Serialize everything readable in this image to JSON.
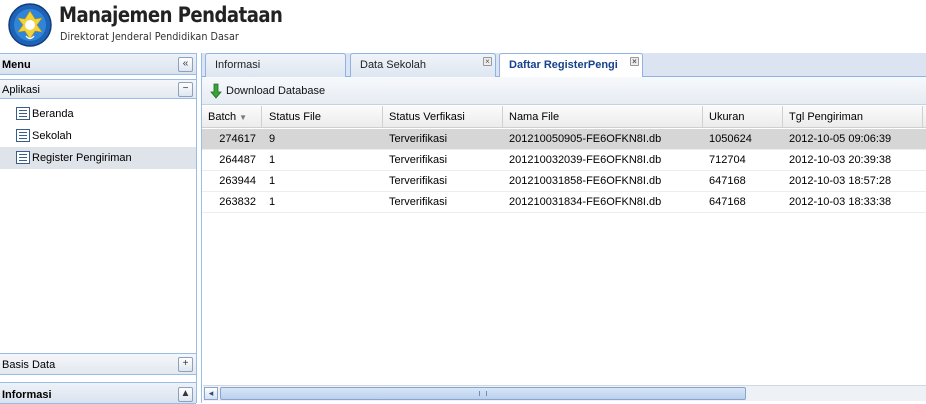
{
  "header": {
    "title": "Manajemen Pendataan",
    "subtitle": "Direktorat Jenderal Pendidikan Dasar"
  },
  "west": {
    "menu_title": "Menu",
    "aplikasi_title": "Aplikasi",
    "tree": [
      {
        "label": "Beranda"
      },
      {
        "label": "Sekolah"
      },
      {
        "label": "Register Pengiriman"
      }
    ],
    "basis_data_title": "Basis Data",
    "informasi_title": "Informasi"
  },
  "tabs": [
    {
      "label": "Informasi"
    },
    {
      "label": "Data Sekolah"
    },
    {
      "label": "Daftar RegisterPengi"
    }
  ],
  "toolbar": {
    "download_label": "Download Database"
  },
  "grid": {
    "columns": [
      "Batch",
      "Status File",
      "Status Verfikasi",
      "Nama File",
      "Ukuran",
      "Tgl Pengiriman"
    ],
    "rows": [
      [
        "274617",
        "9",
        "Terverifikasi",
        "201210050905-FE6OFKN8I.db",
        "1050624",
        "2012-10-05 09:06:39"
      ],
      [
        "264487",
        "1",
        "Terverifikasi",
        "201210032039-FE6OFKN8I.db",
        "712704",
        "2012-10-03 20:39:38"
      ],
      [
        "263944",
        "1",
        "Terverifikasi",
        "201210031858-FE6OFKN8I.db",
        "647168",
        "2012-10-03 18:57:28"
      ],
      [
        "263832",
        "1",
        "Terverifikasi",
        "201210031834-FE6OFKN8I.db",
        "647168",
        "2012-10-03 18:33:38"
      ]
    ]
  },
  "colors": {
    "accent": "#15428b",
    "border": "#99bbe8",
    "selected_row": "#d6d6d6"
  }
}
